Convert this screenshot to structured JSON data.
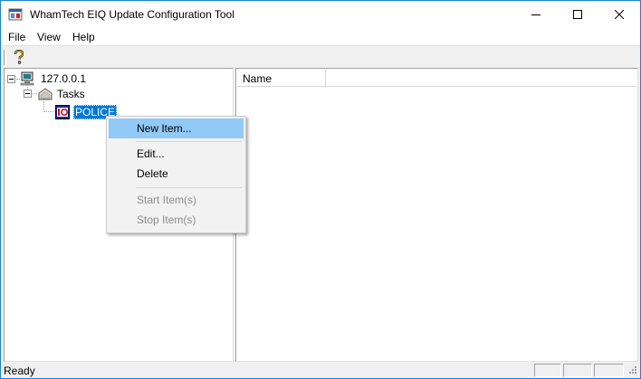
{
  "window": {
    "title": "WhamTech EIQ Update Configuration Tool",
    "accent_border": "#1883d7"
  },
  "menu": [
    "File",
    "View",
    "Help"
  ],
  "toolbar": {
    "help_icon": "help-question-icon"
  },
  "tree": {
    "root": {
      "label": "127.0.0.1",
      "icon": "computer-icon"
    },
    "tasks": {
      "label": "Tasks",
      "icon": "tasks-folder-icon"
    },
    "police": {
      "label": "POLICE",
      "icon": "police-task-icon",
      "selected": true
    }
  },
  "list": {
    "columns": [
      "Name"
    ]
  },
  "context_menu": {
    "items": [
      {
        "label": "New Item...",
        "enabled": true,
        "highlighted": true
      },
      {
        "label": "Edit...",
        "enabled": true
      },
      {
        "label": "Delete",
        "enabled": true
      },
      {
        "label": "Start Item(s)",
        "enabled": false
      },
      {
        "label": "Stop Item(s)",
        "enabled": false
      }
    ]
  },
  "status": {
    "text": "Ready"
  },
  "colors": {
    "selection": "#0078d7",
    "menu_hover": "#91c9f7",
    "disabled_text": "#8d8d8d"
  }
}
